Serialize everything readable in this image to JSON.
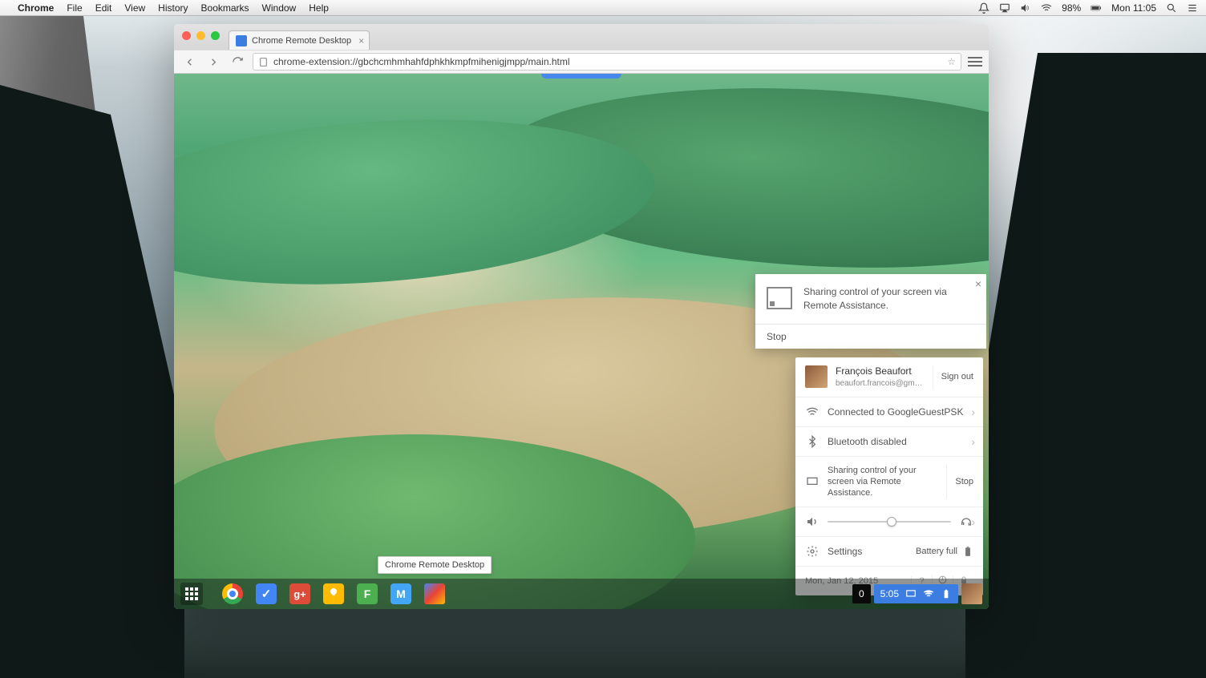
{
  "mac_menubar": {
    "app": "Chrome",
    "menus": [
      "File",
      "Edit",
      "View",
      "History",
      "Bookmarks",
      "Window",
      "Help"
    ],
    "battery": "98%",
    "clock": "Mon 11:05"
  },
  "chrome": {
    "tab_title": "Chrome Remote Desktop",
    "url": "chrome-extension://gbchcmhmhahfdphkhkmpfmihenigjmpp/main.html"
  },
  "notification": {
    "message": "Sharing control of your screen via Remote Assistance.",
    "action": "Stop"
  },
  "status_popup": {
    "user_name": "François Beaufort",
    "user_email": "beaufort.francois@gmail.c...",
    "sign_out": "Sign out",
    "wifi": "Connected to GoogleGuestPSK",
    "bluetooth": "Bluetooth disabled",
    "sharing": "Sharing control of your screen via Remote Assistance.",
    "sharing_stop": "Stop",
    "settings": "Settings",
    "battery": "Battery full",
    "date": "Mon, Jan 12, 2015"
  },
  "shelf": {
    "tooltip": "Chrome Remote Desktop",
    "notification_count": "0",
    "time": "5:05",
    "apps": {
      "gplus": "g+",
      "f": "F",
      "m": "M"
    }
  }
}
